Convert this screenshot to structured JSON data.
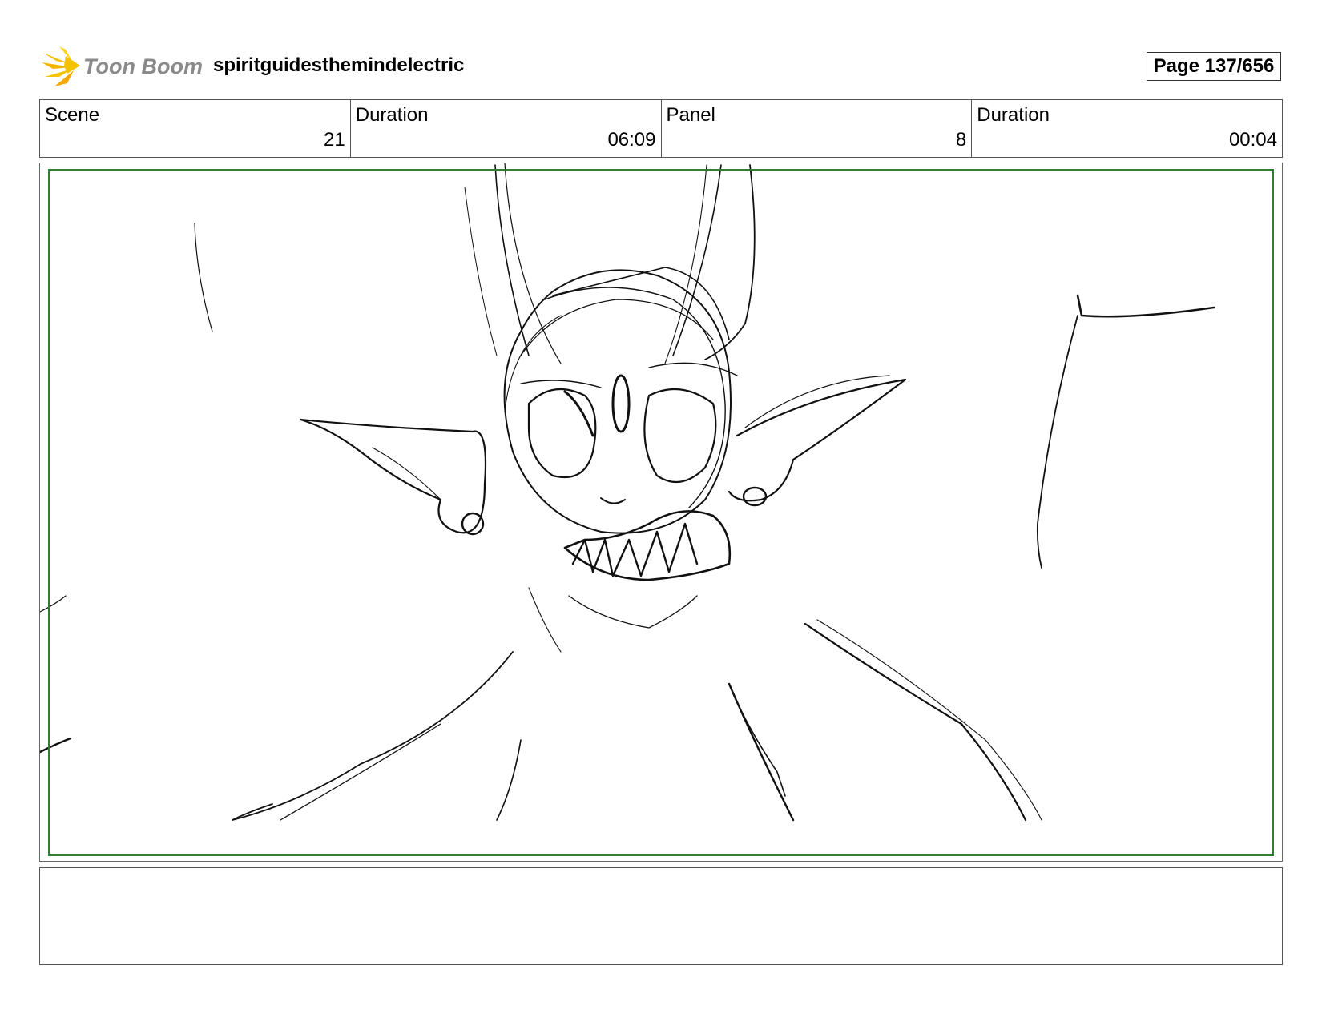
{
  "header": {
    "logo_text": "Toon Boom",
    "project_title": "spiritguidesthemindelectric",
    "page_label": "Page 137/656"
  },
  "info": {
    "scene_label": "Scene",
    "scene_value": "21",
    "scene_duration_label": "Duration",
    "scene_duration_value": "06:09",
    "panel_label": "Panel",
    "panel_value": "8",
    "panel_duration_label": "Duration",
    "panel_duration_value": "00:04"
  },
  "colors": {
    "safe_frame": "#2f7d32",
    "logo_star": "#f5c200",
    "logo_text": "#8a8a8a"
  },
  "notes": {
    "text": ""
  }
}
